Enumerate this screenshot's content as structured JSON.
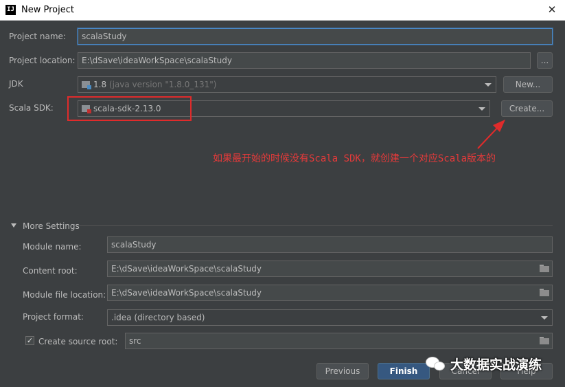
{
  "window": {
    "title": "New Project",
    "app_icon_text": "IJ"
  },
  "project": {
    "name_label": "Project name:",
    "name_value": "scalaStudy",
    "location_label": "Project location:",
    "location_value": "E:\\dSave\\ideaWorkSpace\\scalaStudy",
    "browse_label": "...",
    "jdk_label": "JDK",
    "jdk_value": "1.8",
    "jdk_detail": "(java version \"1.8.0_131\")",
    "jdk_new_button": "New...",
    "scala_sdk_label": "Scala SDK:",
    "scala_sdk_value": "scala-sdk-2.13.0",
    "create_button": "Create..."
  },
  "annotation": {
    "text": "如果最开始的时候没有Scala SDK，就创建一个对应Scala版本的",
    "color": "#e53a3a"
  },
  "more_settings": {
    "toggle_label": "More Settings",
    "module_name_label": "Module name:",
    "module_name_value": "scalaStudy",
    "content_root_label": "Content root:",
    "content_root_value": "E:\\dSave\\ideaWorkSpace\\scalaStudy",
    "module_file_label": "Module file location:",
    "module_file_value": "E:\\dSave\\ideaWorkSpace\\scalaStudy",
    "project_format_label": "Project format:",
    "project_format_value": ".idea (directory based)",
    "create_source_root_label": "Create source root:",
    "create_source_root_checked": true,
    "source_root_value": "src"
  },
  "footer": {
    "previous": "Previous",
    "finish": "Finish",
    "cancel": "Cancel",
    "help": "Help"
  },
  "watermark": {
    "text": "大数据实战演练"
  },
  "colors": {
    "background": "#3c3f41",
    "field": "#45494a",
    "accent_button": "#365880",
    "annotation": "#e02b2b"
  }
}
